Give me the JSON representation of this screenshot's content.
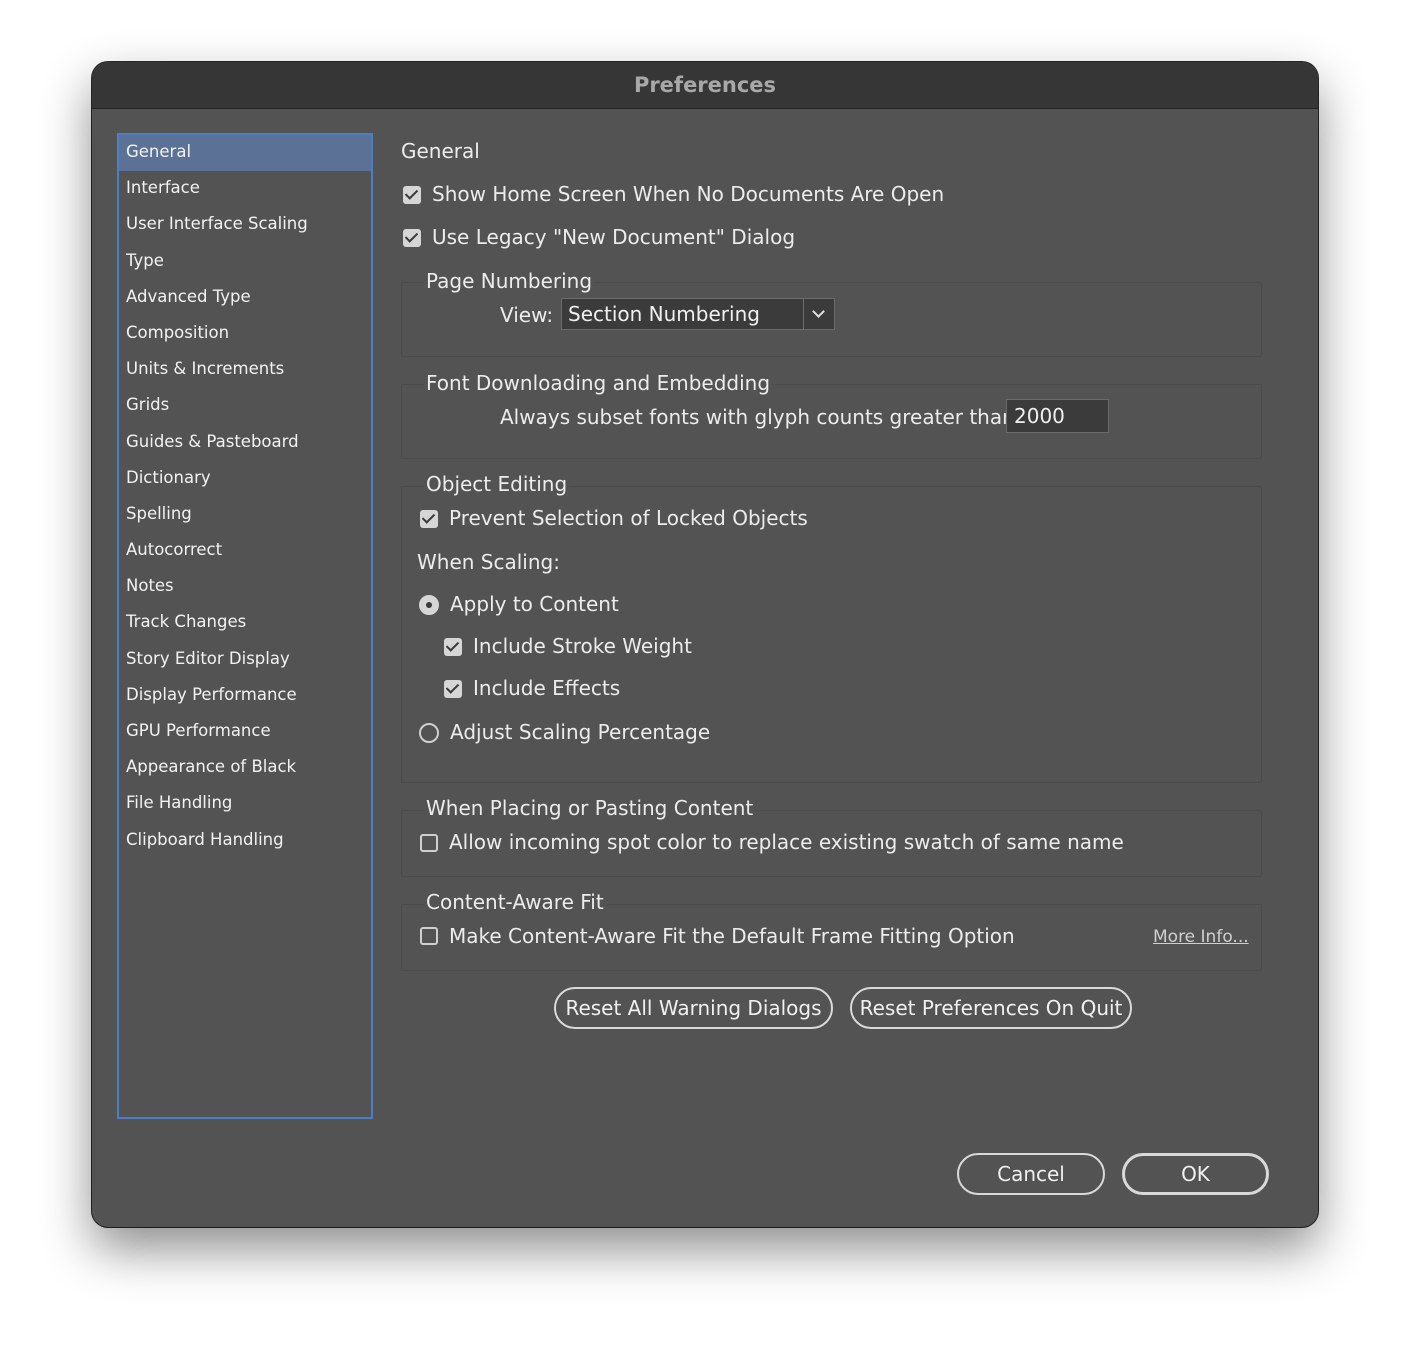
{
  "window": {
    "title": "Preferences"
  },
  "sidebar": {
    "items": [
      {
        "label": "General",
        "selected": true
      },
      {
        "label": "Interface"
      },
      {
        "label": "User Interface Scaling"
      },
      {
        "label": "Type"
      },
      {
        "label": "Advanced Type"
      },
      {
        "label": "Composition"
      },
      {
        "label": "Units & Increments"
      },
      {
        "label": "Grids"
      },
      {
        "label": "Guides & Pasteboard"
      },
      {
        "label": "Dictionary"
      },
      {
        "label": "Spelling"
      },
      {
        "label": "Autocorrect"
      },
      {
        "label": "Notes"
      },
      {
        "label": "Track Changes"
      },
      {
        "label": "Story Editor Display"
      },
      {
        "label": "Display Performance"
      },
      {
        "label": "GPU Performance"
      },
      {
        "label": "Appearance of Black"
      },
      {
        "label": "File Handling"
      },
      {
        "label": "Clipboard Handling"
      }
    ]
  },
  "main": {
    "heading": "General",
    "show_home_screen": {
      "label": "Show Home Screen When No Documents Are Open",
      "checked": true
    },
    "legacy_new_doc": {
      "label": "Use Legacy \"New Document\" Dialog",
      "checked": true
    },
    "page_numbering": {
      "title": "Page Numbering",
      "view_label": "View:",
      "view_value": "Section Numbering"
    },
    "font_downloading": {
      "title": "Font Downloading and Embedding",
      "subset_label": "Always subset fonts with glyph counts greater than:",
      "subset_value": "2000"
    },
    "object_editing": {
      "title": "Object Editing",
      "prevent_locked": {
        "label": "Prevent Selection of Locked Objects",
        "checked": true
      },
      "when_scaling": "When Scaling:",
      "apply_to_content": {
        "label": "Apply to Content",
        "selected": true
      },
      "include_stroke": {
        "label": "Include Stroke Weight",
        "checked": true
      },
      "include_effects": {
        "label": "Include Effects",
        "checked": true
      },
      "adjust_scaling": {
        "label": "Adjust Scaling Percentage",
        "selected": false
      }
    },
    "placing": {
      "title": "When Placing or Pasting Content",
      "allow_spot": {
        "label": "Allow incoming spot color to replace existing swatch of same name",
        "checked": false
      }
    },
    "content_aware": {
      "title": "Content-Aware Fit",
      "make_default": {
        "label": "Make Content-Aware Fit the Default Frame Fitting Option",
        "checked": false
      },
      "more_info": "More Info..."
    },
    "reset_warnings": "Reset All Warning Dialogs",
    "reset_prefs": "Reset Preferences On Quit"
  },
  "footer": {
    "cancel": "Cancel",
    "ok": "OK"
  },
  "colors": {
    "window_bg": "#535353",
    "titlebar_bg": "#363636",
    "sidebar_border": "#4a7fc6",
    "selected_item_bg": "#5c7196"
  },
  "icons": [
    "checkbox-checked-icon",
    "checkbox-unchecked-icon",
    "radio-on-icon",
    "radio-off-icon",
    "chevron-down-icon"
  ]
}
